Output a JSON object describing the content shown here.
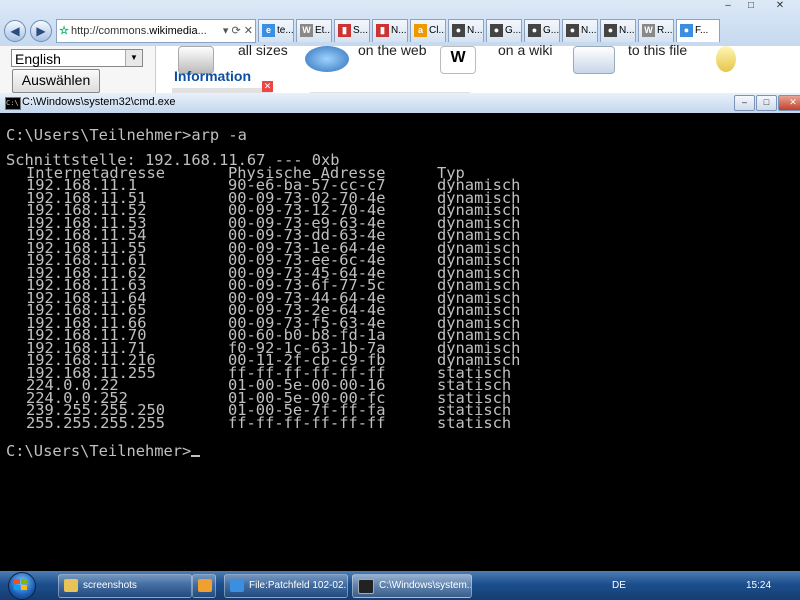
{
  "browser": {
    "address": {
      "prefix": "http://commons.",
      "domain": "wikimedia",
      "suffix": "...",
      "controls": "▾ ⟳ ✕"
    },
    "tabs": [
      {
        "label": "te...",
        "icon": "e"
      },
      {
        "label": "Et...",
        "icon": "W"
      },
      {
        "label": "S...",
        "icon": "▮"
      },
      {
        "label": "N...",
        "icon": "▮"
      },
      {
        "label": "Cl...",
        "icon": "a"
      },
      {
        "label": "N...",
        "icon": "●"
      },
      {
        "label": "G...",
        "icon": "●"
      },
      {
        "label": "G...",
        "icon": "●"
      },
      {
        "label": "N...",
        "icon": "●"
      },
      {
        "label": "N...",
        "icon": "●"
      },
      {
        "label": "R...",
        "icon": "W"
      },
      {
        "label": "F...",
        "icon": "●"
      }
    ],
    "window_controls": {
      "minimize": "–",
      "maximize": "□",
      "close": "✕"
    },
    "language_select": "English",
    "choose_button": "Auswählen",
    "share": [
      "all sizes",
      "on the web",
      "on a wiki",
      "to this file"
    ],
    "info_heading": "Information"
  },
  "cmd": {
    "title": "C:\\Windows\\system32\\cmd.exe",
    "controls": {
      "minimize": "–",
      "maximize": "□",
      "close": "✕"
    },
    "prompt": "C:\\Users\\Teilnehmer>",
    "command": "arp -a",
    "interface_line": "Schnittstelle: 192.168.11.67 --- 0xb",
    "headers": {
      "ip": "Internetadresse",
      "mac": "Physische Adresse",
      "type": "Typ"
    },
    "rows": [
      {
        "ip": "192.168.11.1",
        "mac": "90-e6-ba-57-cc-c7",
        "type": "dynamisch"
      },
      {
        "ip": "192.168.11.51",
        "mac": "00-09-73-02-70-4e",
        "type": "dynamisch"
      },
      {
        "ip": "192.168.11.52",
        "mac": "00-09-73-12-70-4e",
        "type": "dynamisch"
      },
      {
        "ip": "192.168.11.53",
        "mac": "00-09-73-e9-63-4e",
        "type": "dynamisch"
      },
      {
        "ip": "192.168.11.54",
        "mac": "00-09-73-dd-63-4e",
        "type": "dynamisch"
      },
      {
        "ip": "192.168.11.55",
        "mac": "00-09-73-1e-64-4e",
        "type": "dynamisch"
      },
      {
        "ip": "192.168.11.61",
        "mac": "00-09-73-ee-6c-4e",
        "type": "dynamisch"
      },
      {
        "ip": "192.168.11.62",
        "mac": "00-09-73-45-64-4e",
        "type": "dynamisch"
      },
      {
        "ip": "192.168.11.63",
        "mac": "00-09-73-6f-77-5c",
        "type": "dynamisch"
      },
      {
        "ip": "192.168.11.64",
        "mac": "00-09-73-44-64-4e",
        "type": "dynamisch"
      },
      {
        "ip": "192.168.11.65",
        "mac": "00-09-73-2e-64-4e",
        "type": "dynamisch"
      },
      {
        "ip": "192.168.11.66",
        "mac": "00-09-73-f5-63-4e",
        "type": "dynamisch"
      },
      {
        "ip": "192.168.11.70",
        "mac": "00-60-b0-b8-fd-1a",
        "type": "dynamisch"
      },
      {
        "ip": "192.168.11.71",
        "mac": "f0-92-1c-63-1b-7a",
        "type": "dynamisch"
      },
      {
        "ip": "192.168.11.216",
        "mac": "00-11-2f-cb-c9-fb",
        "type": "dynamisch"
      },
      {
        "ip": "192.168.11.255",
        "mac": "ff-ff-ff-ff-ff-ff",
        "type": "statisch"
      },
      {
        "ip": "224.0.0.22",
        "mac": "01-00-5e-00-00-16",
        "type": "statisch"
      },
      {
        "ip": "224.0.0.252",
        "mac": "01-00-5e-00-00-fc",
        "type": "statisch"
      },
      {
        "ip": "239.255.255.250",
        "mac": "01-00-5e-7f-ff-fa",
        "type": "statisch"
      },
      {
        "ip": "255.255.255.255",
        "mac": "ff-ff-ff-ff-ff-ff",
        "type": "statisch"
      }
    ]
  },
  "taskbar": {
    "items": [
      {
        "label": "screenshots",
        "icon": "folder-icon",
        "color": "#e8c35a"
      },
      {
        "label": "",
        "icon": "media-player-icon",
        "color": "#f0a030"
      },
      {
        "label": "File:Patchfeld 102-02...",
        "icon": "internet-explorer-icon",
        "color": "#3a8fe0"
      },
      {
        "label": "C:\\Windows\\system...",
        "icon": "cmd-icon",
        "color": "#222222"
      }
    ],
    "language": "DE",
    "clock": "15:24"
  },
  "colors": {
    "console_bg": "#000000",
    "console_fg": "#c0c0c0",
    "taskbar": "#1c4f8e",
    "link": "#0b4ea2"
  }
}
